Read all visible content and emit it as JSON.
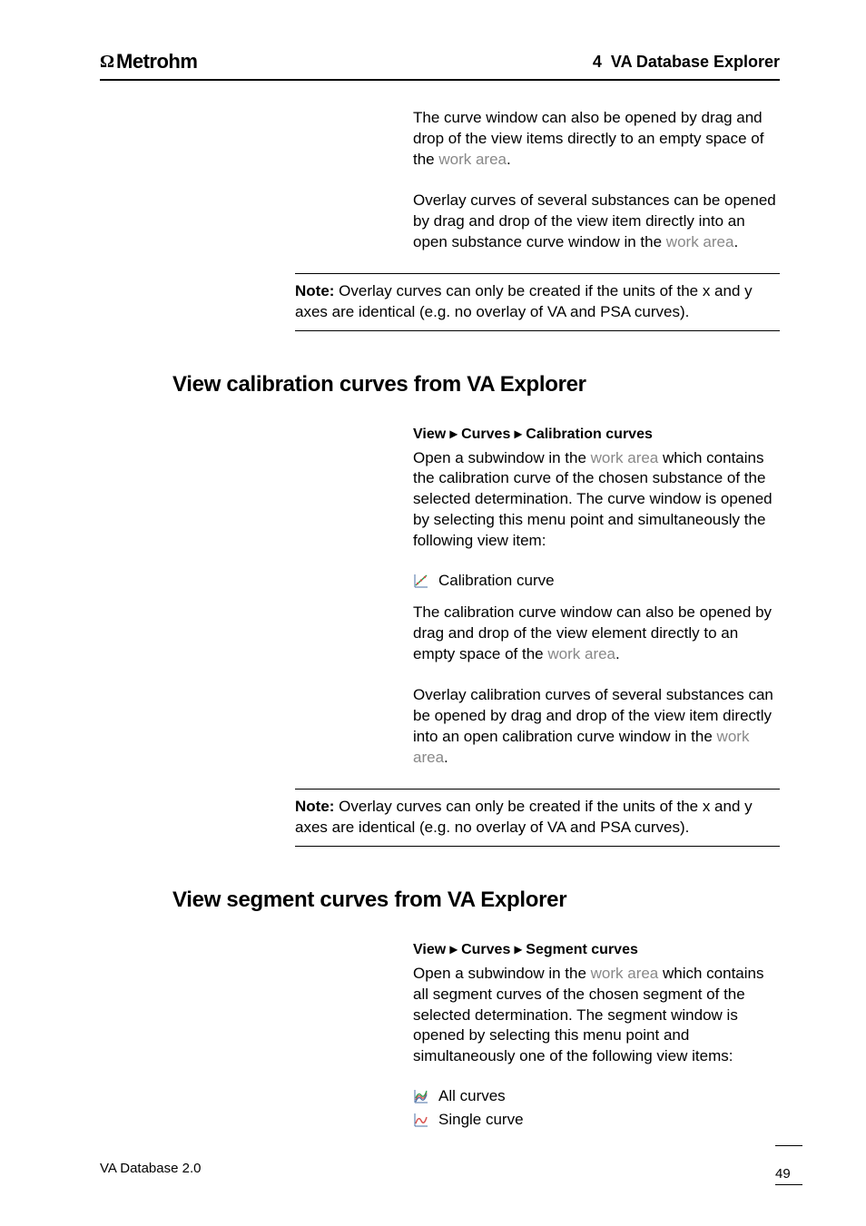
{
  "header": {
    "brand": "Metrohm",
    "chapter_num": "4",
    "chapter_title": "VA Database Explorer"
  },
  "block1": {
    "p1a": "The curve window can also be opened by drag and drop of the view items directly to an empty space of the ",
    "p1_area": "work area",
    "p1_end": ".",
    "p2a": "Overlay curves of several substances can be opened by drag and drop of the view item directly into an open substance curve window in the ",
    "p2_area": "work area",
    "p2_end": "."
  },
  "note1": {
    "label": "Note:",
    "text": " Overlay curves can only be created if the units of the x and y axes are identical (e.g. no overlay of VA and PSA curves)."
  },
  "section2": {
    "heading": "View calibration curves from VA Explorer",
    "menu": "View ▸ Curves ▸ Calibration curves",
    "p1a": "Open a subwindow in the ",
    "p1_area": "work area",
    "p1b": " which contains the calibration curve of the chosen substance of the selected determination. The curve window is opened by selecting this menu point and simultaneously the following view item:",
    "icon_label": "Calibration curve",
    "p2a": "The calibration curve window can also be opened by drag and drop of the view element directly to an empty space of the ",
    "p2_area": "work area",
    "p2_end": ".",
    "p3a": "Overlay calibration curves of several substances can be opened by drag and drop of the view item directly into an open calibration curve window in the ",
    "p3_area": "work area",
    "p3_end": "."
  },
  "note2": {
    "label": "Note:",
    "text": " Overlay curves can only be created if the units of the x and y axes are identical (e.g. no overlay of VA and PSA curves)."
  },
  "section3": {
    "heading": "View segment curves from VA Explorer",
    "menu": "View ▸ Curves ▸ Segment curves",
    "p1a": "Open a subwindow in the ",
    "p1_area": "work area",
    "p1b": " which contains all segment curves of the chosen segment of the selected determination. The segment window is opened by selecting this menu point and simultaneously one of the following view items:",
    "icon1_label": "All curves",
    "icon2_label": "Single curve"
  },
  "footer": {
    "product": "VA Database 2.0",
    "page": "49"
  }
}
